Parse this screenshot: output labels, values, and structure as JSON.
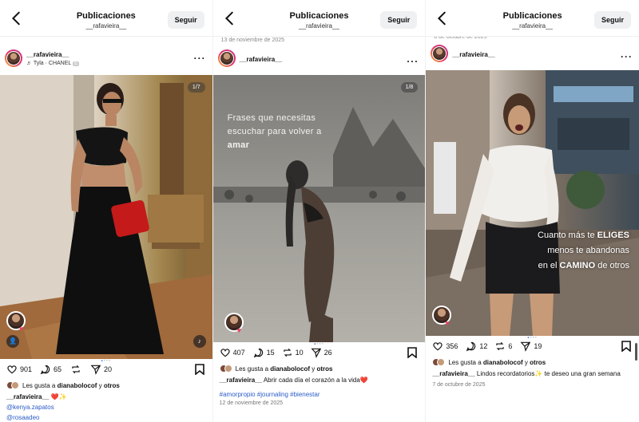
{
  "panels": [
    {
      "header": {
        "title": "Publicaciones",
        "username": "__rafavieira__",
        "follow_label": "Seguir"
      },
      "date_top": "",
      "post": {
        "username": "__rafavieira__",
        "music": "Tyla · CHANEL",
        "music_badge": "E",
        "counter": "1/7",
        "likes": "901",
        "comments": "65",
        "shares": "20",
        "liked_by_prefix": "Les gusta a ",
        "liked_by_user": "dianabolocof",
        "liked_by_mid": " y ",
        "liked_by_others": "otros",
        "caption_user": "__rafavieira__",
        "caption_text": " ❤️✨",
        "mention1": "@kenya.zapatos",
        "mention2": "@rosaadeo"
      }
    },
    {
      "header": {
        "title": "Publicaciones",
        "username": "__rafavieira__",
        "follow_label": "Seguir"
      },
      "date_top": "13 de noviembre de 2025",
      "post": {
        "username": "__rafavieira__",
        "counter": "1/8",
        "overlay_line1": "Frases que necesitas",
        "overlay_line2": "escuchar para volver a",
        "overlay_line3": "amar",
        "likes": "407",
        "comments": "15",
        "reposts": "10",
        "shares": "26",
        "liked_by_prefix": "Les gusta a ",
        "liked_by_user": "dianabolocof",
        "liked_by_mid": " y ",
        "liked_by_others": "otros",
        "caption_user": "__rafavieira__",
        "caption_text": " Abrir cada día el corazón a la vida❤️",
        "tags": "#amorpropio #journaling #bienestar",
        "date": "12 de noviembre de 2025"
      }
    },
    {
      "header": {
        "title": "Publicaciones",
        "username": "__rafavieira__",
        "follow_label": "Seguir"
      },
      "date_top": "8 de octubre de 2025",
      "post": {
        "username": "__rafavieira__",
        "overlay_l1a": "Cuanto más te ",
        "overlay_l1b": "ELIGES",
        "overlay_l2": "menos te abandonas",
        "overlay_l3a": "en el ",
        "overlay_l3b": "CAMINO",
        "overlay_l3c": " de otros",
        "likes": "356",
        "comments": "12",
        "reposts": "6",
        "shares": "19",
        "liked_by_prefix": "Les gusta a ",
        "liked_by_user": "dianabolocof",
        "liked_by_mid": " y ",
        "liked_by_others": "otros",
        "caption_user": "__rafavieira__",
        "caption_text": " Lindos recordatorios✨  te deseo una gran semana",
        "date": "7 de octubre de 2025"
      }
    }
  ],
  "colors": {
    "link": "#2b5cc8",
    "accent_dot": "#3b82f6",
    "heart": "#e93e66"
  }
}
